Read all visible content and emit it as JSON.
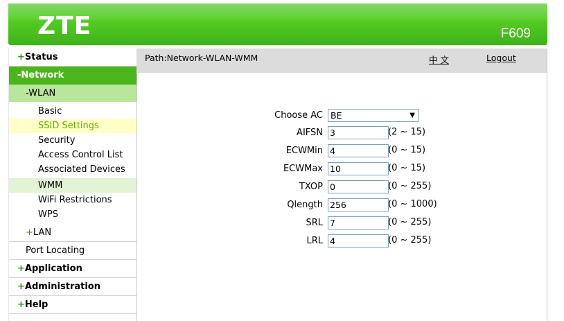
{
  "header": {
    "logo": "ZTE",
    "model": "F609"
  },
  "sidebar": {
    "status": {
      "sign": "+",
      "label": "Status"
    },
    "network": {
      "sign": "-",
      "label": "Network"
    },
    "wlan": {
      "sign": "-",
      "label": "WLAN"
    },
    "wlan_items": [
      "Basic",
      "SSID Settings",
      "Security",
      "Access Control List",
      "Associated Devices",
      "WMM",
      "WiFi Restrictions",
      "WPS"
    ],
    "lan": {
      "sign": "+",
      "label": "LAN"
    },
    "port_locating": "Port Locating",
    "application": {
      "sign": "+",
      "label": "Application"
    },
    "administration": {
      "sign": "+",
      "label": "Administration"
    },
    "help": {
      "sign": "+",
      "label": "Help"
    }
  },
  "pathbar": {
    "path": "Path:Network-WLAN-WMM",
    "lang": "中 文",
    "logout": "Logout"
  },
  "form": {
    "choose_ac": {
      "label": "Choose AC",
      "value": "BE",
      "arrow": "▼"
    },
    "fields": [
      {
        "label": "AIFSN",
        "value": "3",
        "range": "(2 ~ 15)"
      },
      {
        "label": "ECWMin",
        "value": "4",
        "range": "(0 ~ 15)"
      },
      {
        "label": "ECWMax",
        "value": "10",
        "range": "(0 ~ 15)"
      },
      {
        "label": "TXOP",
        "value": "0",
        "range": "(0 ~ 255)"
      },
      {
        "label": "Qlength",
        "value": "256",
        "range": "(0 ~ 1000)"
      },
      {
        "label": "SRL",
        "value": "7",
        "range": "(0 ~ 255)"
      },
      {
        "label": "LRL",
        "value": "4",
        "range": "(0 ~ 255)"
      }
    ]
  },
  "colors": {
    "brand_green": "#4cb51c",
    "sub_green": "#b8e69a",
    "selected_bg": "#ffffc8",
    "selected_text": "#66aa00"
  }
}
